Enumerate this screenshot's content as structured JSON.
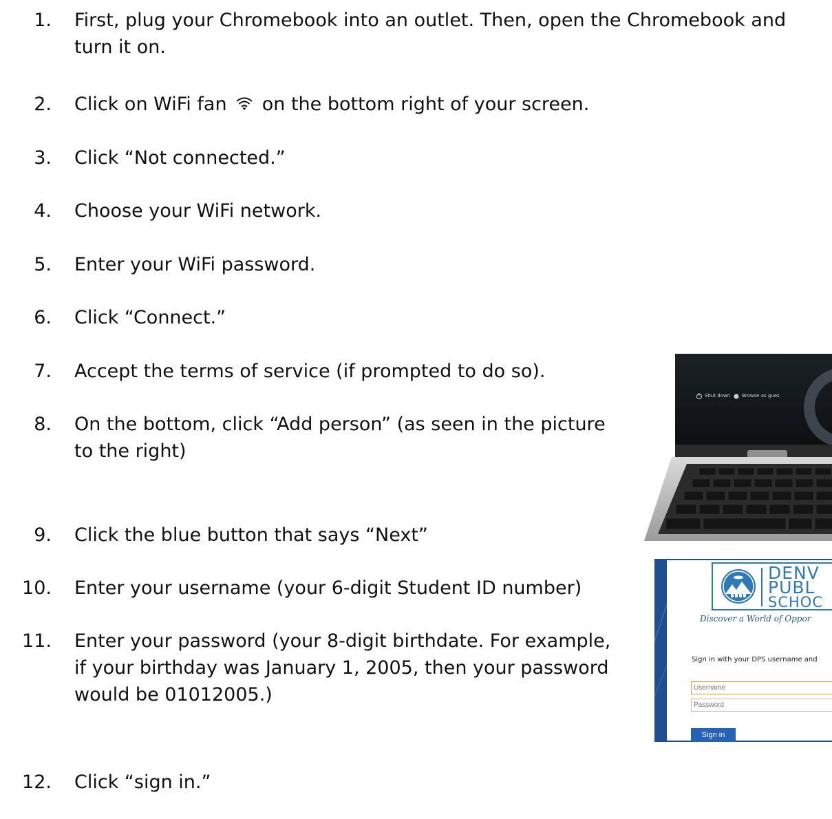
{
  "steps": [
    {
      "num": "1.",
      "lines": [
        "First, plug your Chromebook into an outlet.  Then, open the Chromebook and",
        "turn it on."
      ]
    },
    {
      "num": "2.",
      "before_icon": "Click on WiFi fan",
      "icon": "wifi-icon",
      "after_icon": "on the bottom right of your screen."
    },
    {
      "num": "3.",
      "lines": [
        "Click “Not connected.”"
      ]
    },
    {
      "num": "4.",
      "lines": [
        "Choose your WiFi network."
      ]
    },
    {
      "num": "5.",
      "lines": [
        "Enter your WiFi password."
      ]
    },
    {
      "num": "6.",
      "lines": [
        "Click “Connect.”"
      ]
    },
    {
      "num": "7.",
      "lines": [
        "Accept the terms of service (if prompted to do so)."
      ]
    },
    {
      "num": "8.",
      "lines": [
        "On the bottom, click “Add person” (as seen in the picture",
        "to the right)"
      ]
    },
    {
      "num": "9.",
      "lines": [
        "Click the blue button that says “Next”"
      ]
    },
    {
      "num": "10.",
      "lines": [
        "Enter your username (your 6-digit Student ID number)"
      ]
    },
    {
      "num": "11.",
      "lines": [
        "Enter your password (your 8-digit birthdate. For example,",
        "if your birthday was January 1, 2005, then your password",
        "would be 01012005.)"
      ]
    },
    {
      "num": "12.",
      "lines": [
        "Click “sign in.”"
      ]
    }
  ],
  "laptop_image": {
    "shut_down_label": "Shut down",
    "browse_label": "Browse as gues"
  },
  "signin_image": {
    "brand_line1": "DENV",
    "brand_line2": "PUBL",
    "brand_line3": "SCHOC",
    "tagline": "Discover a World of Oppor",
    "prompt": "Sign in with your DPS username and",
    "username_placeholder": "Username",
    "password_placeholder": "Password",
    "signin_button": "Sign in"
  },
  "colors": {
    "dps_blue": "#2e79b6",
    "sign_in_button": "#2563b8",
    "frame_blue": "#1e4f92"
  }
}
